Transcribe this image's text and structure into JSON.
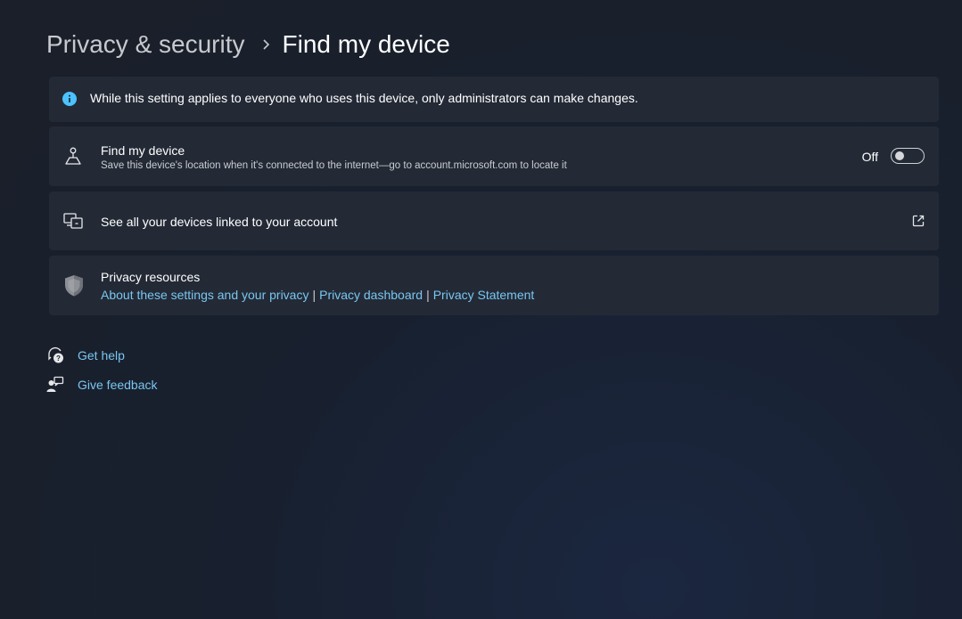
{
  "breadcrumb": {
    "parent": "Privacy & security",
    "separator": "›",
    "current": "Find my device"
  },
  "info_bar": {
    "icon": "info-icon",
    "text": "While this setting applies to everyone who uses this device, only administrators can make changes."
  },
  "find_my_device": {
    "icon": "person-location-icon",
    "title": "Find my device",
    "description": "Save this device's location when it's connected to the internet—go to account.microsoft.com to locate it",
    "toggle_state_label": "Off",
    "toggle_on": false
  },
  "linked_devices": {
    "icon": "devices-icon",
    "label": "See all your devices linked to your account",
    "action_icon": "external-link-icon"
  },
  "privacy_resources": {
    "icon": "shield-icon",
    "title": "Privacy resources",
    "links": [
      "About these settings and your privacy",
      "Privacy dashboard",
      "Privacy Statement"
    ],
    "separator": "|"
  },
  "footer_links": {
    "get_help": "Get help",
    "give_feedback": "Give feedback"
  },
  "colors": {
    "link": "#79c6f1",
    "info_icon": "#4cc2ff",
    "card_bg": "#232a36"
  }
}
